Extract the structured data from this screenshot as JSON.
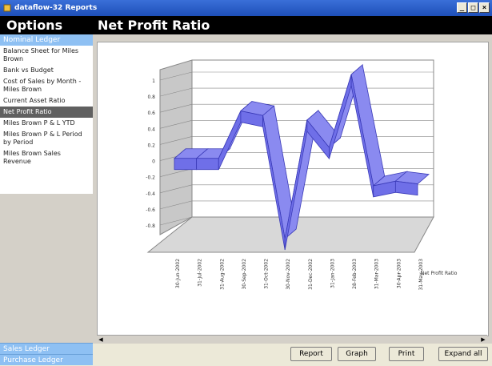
{
  "window": {
    "title": "dataflow-32 Reports",
    "icon": "app-icon"
  },
  "sidebar": {
    "header": "Options",
    "group_top": "Nominal Ledger",
    "items": [
      "Balance Sheet for Miles Brown",
      "Bank vs Budget",
      "Cost of Sales by Month - Miles Brown",
      "Current Asset Ratio",
      "Net Profit Ratio",
      "Miles Brown P & L YTD",
      "Miles Brown P & L Period by Period",
      "Miles Brown Sales Revenue"
    ],
    "selected_index": 4,
    "groups_bottom": [
      "Sales Ledger",
      "Purchase Ledger"
    ]
  },
  "main": {
    "title": "Net Profit Ratio"
  },
  "buttons": {
    "report": "Report",
    "graph": "Graph",
    "print": "Print",
    "expand": "Expand all"
  },
  "chart_data": {
    "type": "line",
    "style": "3d-ribbon",
    "color": "#6f6fe8",
    "grid": true,
    "ylim": [
      -0.8,
      1
    ],
    "yticks": [
      "1",
      "0.8",
      "0.6",
      "0.4",
      "0.2",
      "0",
      "-0.2",
      "-0.4",
      "-0.6",
      "-0.8"
    ],
    "categories": [
      "30-Jun-2002",
      "31-Jul-2002",
      "31-Aug-2002",
      "30-Sep-2002",
      "31-Oct-2002",
      "30-Nov-2002",
      "31-Dec-2002",
      "31-Jan-2003",
      "28-Feb-2003",
      "31-Mar-2003",
      "30-Apr-2003",
      "31-May-2003"
    ],
    "series": [
      {
        "name": "Net Profit Ratio",
        "values": [
          0.08,
          0.08,
          0.08,
          0.6,
          0.55,
          -0.8,
          0.5,
          0.2,
          1.0,
          -0.22,
          -0.17,
          -0.2
        ]
      }
    ]
  }
}
